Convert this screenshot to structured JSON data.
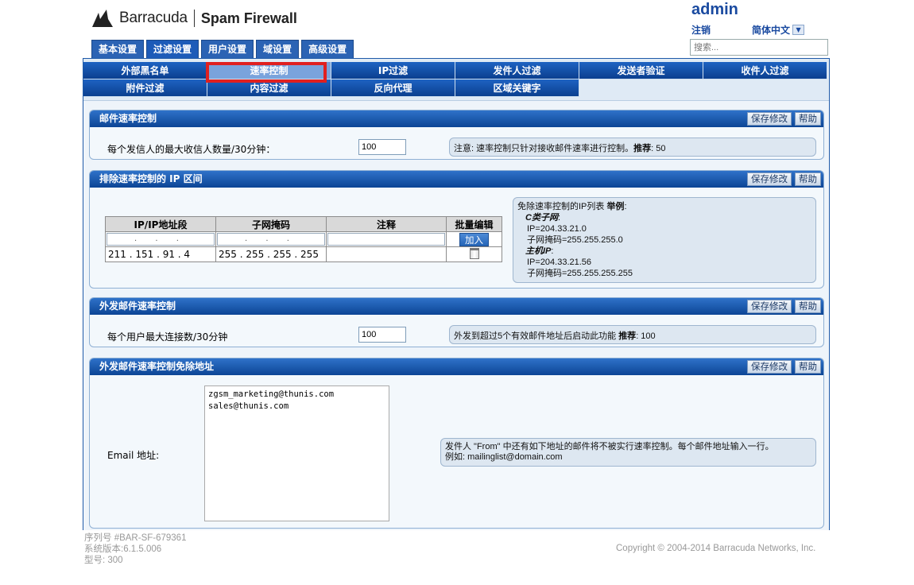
{
  "header": {
    "brand": "Barracuda",
    "product": "Spam Firewall",
    "user": "admin",
    "logout": "注销",
    "language": "简体中文",
    "search_placeholder": "搜索..."
  },
  "main_tabs": [
    "基本设置",
    "过滤设置",
    "用户设置",
    "域设置",
    "高级设置"
  ],
  "active_main_tab": "过滤设置",
  "sub_nav": {
    "row1": [
      "外部黑名单",
      "速率控制",
      "IP过滤",
      "发件人过滤",
      "发送者验证",
      "收件人过滤"
    ],
    "row2": [
      "附件过滤",
      "内容过滤",
      "反向代理",
      "区域关键字"
    ],
    "active": "速率控制"
  },
  "buttons": {
    "save": "保存修改",
    "help": "帮助",
    "add": "加入"
  },
  "panel_rate": {
    "title": "邮件速率控制",
    "label": "每个发信人的最大收信人数量/30分钟：",
    "value": "100",
    "note_prefix": "注意: 速率控制只针对接收邮件速率进行控制。",
    "note_bold": "推荐",
    "note_suffix": ": 50"
  },
  "panel_exempt": {
    "title": "排除速率控制的 IP 区间",
    "columns": [
      "IP/IP地址段",
      "子网掩码",
      "注释",
      "批量编辑"
    ],
    "input_placeholder_ip": ". . .",
    "rows": [
      {
        "ip": "211 . 151 . 91 .  4",
        "mask": "255 . 255 . 255 . 255",
        "comment": ""
      }
    ],
    "note_title": "免除速率控制的IP列表",
    "note_example": "举例",
    "note_c_class": "C类子网",
    "note_ip1": "IP=204.33.21.0",
    "note_mask1": "子网掩码=255.255.255.0",
    "note_host": "主机IP",
    "note_ip2": "IP=204.33.21.56",
    "note_mask2": "子网掩码=255.255.255.255"
  },
  "panel_outbound": {
    "title": "外发邮件速率控制",
    "label": "每个用户最大连接数/30分钟",
    "value": "100",
    "note_prefix": "外发到超过5个有效邮件地址后启动此功能",
    "note_bold": "推荐",
    "note_suffix": ": 100"
  },
  "panel_outbound_exempt": {
    "title": "外发邮件速率控制免除地址",
    "label": "Email 地址:",
    "emails": [
      "zgsm_marketing@thunis.com",
      "sales@thunis.com"
    ],
    "note_line1": "发件人 \"From\" 中还有如下地址的邮件将不被实行速率控制。每个邮件地址输入一行。",
    "note_line2": "例如: mailinglist@domain.com"
  },
  "footer": {
    "serial": "序列号 #BAR-SF-679361",
    "version": "系统版本:6.1.5.006",
    "model": "型号: 300",
    "copyright": "Copyright © 2004-2014 Barracuda Networks, Inc."
  },
  "colors": {
    "accent": "#1a4aa0",
    "nav_dark": "#0b3f8f",
    "highlight": "#e02020"
  }
}
